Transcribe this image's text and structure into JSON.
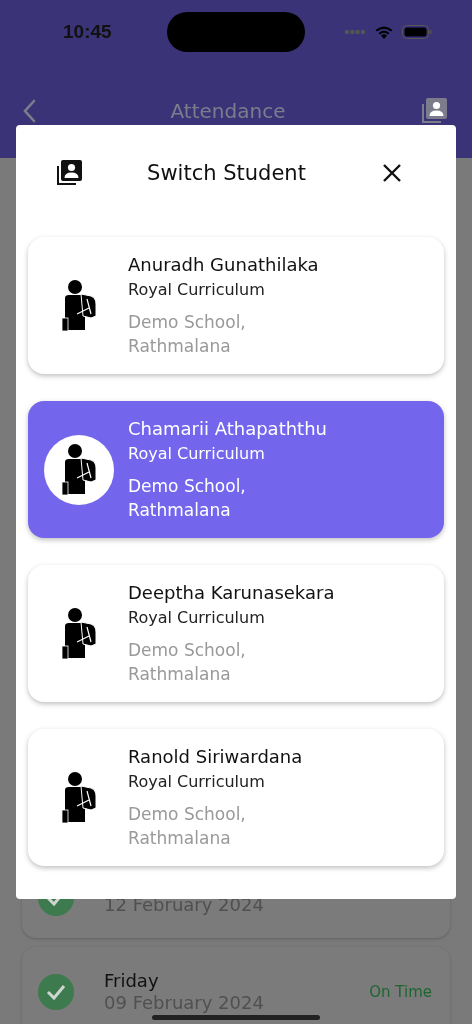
{
  "status_bar": {
    "time": "10:45"
  },
  "app_bar": {
    "title": "Attendance"
  },
  "background_records": [
    {
      "date": "12 February 2024",
      "present": true
    },
    {
      "day": "Friday",
      "date": "09 February 2024",
      "status": "On Time",
      "present": true
    }
  ],
  "dialog": {
    "title": "Switch Student",
    "students": [
      {
        "name": "Anuradh Gunathilaka",
        "curriculum": "Royal Curriculum",
        "school": "Demo School,\nRathmalana",
        "selected": false
      },
      {
        "name": "Chamarii Athapaththu",
        "curriculum": "Royal Curriculum",
        "school": "Demo School,\nRathmalana",
        "selected": true
      },
      {
        "name": "Deeptha Karunasekara",
        "curriculum": "Royal Curriculum",
        "school": "Demo School,\nRathmalana",
        "selected": false
      },
      {
        "name": "Ranold Siriwardana",
        "curriculum": "Royal Curriculum",
        "school": "Demo School,\nRathmalana",
        "selected": false
      }
    ]
  }
}
